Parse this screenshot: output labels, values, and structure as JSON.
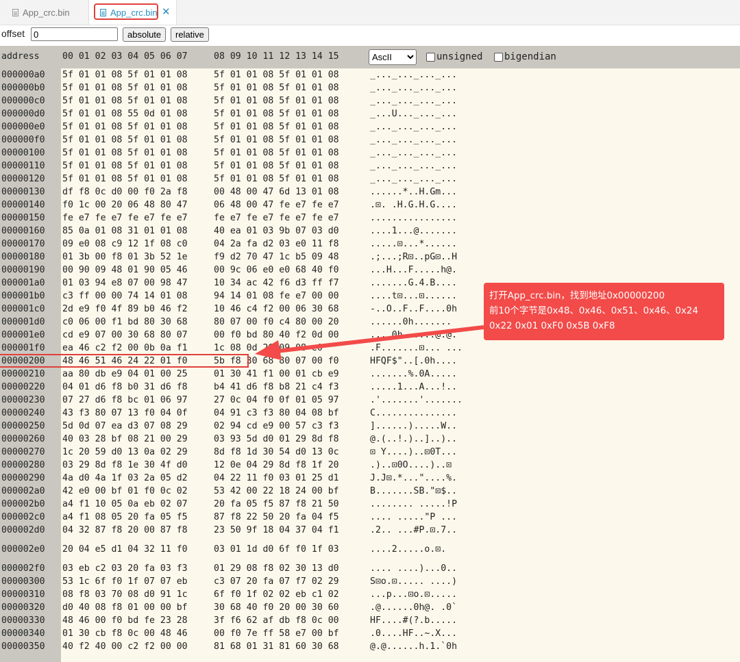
{
  "tabs": [
    {
      "label": "App_crc.bin",
      "active": false
    },
    {
      "label": "App_crc.bin",
      "active": true
    }
  ],
  "toolbar": {
    "offset_label": "offset",
    "offset_value": "0",
    "absolute_label": "absolute",
    "relative_label": "relative"
  },
  "header": {
    "address_label": "address",
    "cols_left": "00 01 02 03 04 05 06 07",
    "cols_right": "08 09 10 11 12 13 14 15",
    "encoding": "AscII",
    "unsigned_label": "unsigned",
    "bigendian_label": "bigendian"
  },
  "rows": [
    {
      "addr": "000000a0",
      "h1": "5f 01 01 08 5f 01 01 08",
      "h2": "5f 01 01 08 5f 01 01 08",
      "ascii": "_..._..._..._..."
    },
    {
      "addr": "000000b0",
      "h1": "5f 01 01 08 5f 01 01 08",
      "h2": "5f 01 01 08 5f 01 01 08",
      "ascii": "_..._..._..._..."
    },
    {
      "addr": "000000c0",
      "h1": "5f 01 01 08 5f 01 01 08",
      "h2": "5f 01 01 08 5f 01 01 08",
      "ascii": "_..._..._..._..."
    },
    {
      "addr": "000000d0",
      "h1": "5f 01 01 08 55 0d 01 08",
      "h2": "5f 01 01 08 5f 01 01 08",
      "ascii": "_...U..._..._..."
    },
    {
      "addr": "000000e0",
      "h1": "5f 01 01 08 5f 01 01 08",
      "h2": "5f 01 01 08 5f 01 01 08",
      "ascii": "_..._..._..._..."
    },
    {
      "addr": "000000f0",
      "h1": "5f 01 01 08 5f 01 01 08",
      "h2": "5f 01 01 08 5f 01 01 08",
      "ascii": "_..._..._..._..."
    },
    {
      "addr": "00000100",
      "h1": "5f 01 01 08 5f 01 01 08",
      "h2": "5f 01 01 08 5f 01 01 08",
      "ascii": "_..._..._..._..."
    },
    {
      "addr": "00000110",
      "h1": "5f 01 01 08 5f 01 01 08",
      "h2": "5f 01 01 08 5f 01 01 08",
      "ascii": "_..._..._..._..."
    },
    {
      "addr": "00000120",
      "h1": "5f 01 01 08 5f 01 01 08",
      "h2": "5f 01 01 08 5f 01 01 08",
      "ascii": "_..._..._..._..."
    },
    {
      "addr": "00000130",
      "h1": "df f8 0c d0 00 f0 2a f8",
      "h2": "00 48 00 47 6d 13 01 08",
      "ascii": "......*..H.Gm..."
    },
    {
      "addr": "00000140",
      "h1": "f0 1c 00 20 06 48 80 47",
      "h2": "06 48 00 47 fe e7 fe e7",
      "ascii": ".⊡. .H.G.H.G...."
    },
    {
      "addr": "00000150",
      "h1": "fe e7 fe e7 fe e7 fe e7",
      "h2": "fe e7 fe e7 fe e7 fe e7",
      "ascii": "................"
    },
    {
      "addr": "00000160",
      "h1": "85 0a 01 08 31 01 01 08",
      "h2": "40 ea 01 03 9b 07 03 d0",
      "ascii": "....1...@......."
    },
    {
      "addr": "00000170",
      "h1": "09 e0 08 c9 12 1f 08 c0",
      "h2": "04 2a fa d2 03 e0 11 f8",
      "ascii": ".....⊡...*......"
    },
    {
      "addr": "00000180",
      "h1": "01 3b 00 f8 01 3b 52 1e",
      "h2": "f9 d2 70 47 1c b5 09 48",
      "ascii": ".;...;R⊡..pG⊡..H"
    },
    {
      "addr": "00000190",
      "h1": "00 90 09 48 01 90 05 46",
      "h2": "00 9c 06 e0 e0 68 40 f0",
      "ascii": "...H...F.....h@."
    },
    {
      "addr": "000001a0",
      "h1": "01 03 94 e8 07 00 98 47",
      "h2": "10 34 ac 42 f6 d3 ff f7",
      "ascii": ".......G.4.B...."
    },
    {
      "addr": "000001b0",
      "h1": "c3 ff 00 00 74 14 01 08",
      "h2": "94 14 01 08 fe e7 00 00",
      "ascii": "....t⊡...⊡......"
    },
    {
      "addr": "000001c0",
      "h1": "2d e9 f0 4f 89 b0 46 f2",
      "h2": "10 46 c4 f2 00 06 30 68",
      "ascii": "-..O..F..F....0h"
    },
    {
      "addr": "000001d0",
      "h1": "c0 06 00 f1 bd 80 30 68",
      "h2": "80 07 00 f0 c4 80 00 20",
      "ascii": "......0h....... "
    },
    {
      "addr": "000001e0",
      "h1": "cd e9 07 00 30 68 80 07",
      "h2": "00 f0 bd 80 40 f2 0d 00",
      "ascii": "....0h......@.@."
    },
    {
      "addr": "000001f0",
      "h1": "ea 46 c2 f2 00 0b 0a f1",
      "h2": "1c 08 0d 20 09 08 e0",
      "ascii": ".F.......⊡... ..."
    },
    {
      "addr": "00000200",
      "h1": "48 46 51 46 24 22 01 f0",
      "h2": "5b f8 30 68 80 07 00 f0",
      "ascii": "HFQF$\"..[.0h...."
    },
    {
      "addr": "00000210",
      "h1": "aa 80 db e9 04 01 00 25",
      "h2": "01 30 41 f1 00 01 cb e9",
      "ascii": ".......%.0A....."
    },
    {
      "addr": "00000220",
      "h1": "04 01 d6 f8 b0 31 d6 f8",
      "h2": "b4 41 d6 f8 b8 21 c4 f3",
      "ascii": ".....1...A...!.."
    },
    {
      "addr": "00000230",
      "h1": "07 27 d6 f8 bc 01 06 97",
      "h2": "27 0c 04 f0 0f 01 05 97",
      "ascii": ".'.......'......."
    },
    {
      "addr": "00000240",
      "h1": "43 f3 80 07 13 f0 04 0f",
      "h2": "04 91 c3 f3 80 04 08 bf",
      "ascii": "C..............."
    },
    {
      "addr": "00000250",
      "h1": "5d 0d 07 ea d3 07 08 29",
      "h2": "02 94 cd e9 00 57 c3 f3",
      "ascii": "]......).....W.."
    },
    {
      "addr": "00000260",
      "h1": "40 03 28 bf 08 21 00 29",
      "h2": "03 93 5d d0 01 29 8d f8",
      "ascii": "@.(..!.)..]..).."
    },
    {
      "addr": "00000270",
      "h1": "1c 20 59 d0 13 0a 02 29",
      "h2": "8d f8 1d 30 54 d0 13 0c",
      "ascii": "⊡ Y....)..⊡0T..."
    },
    {
      "addr": "00000280",
      "h1": "03 29 8d f8 1e 30 4f d0",
      "h2": "12 0e 04 29 8d f8 1f 20",
      "ascii": ".)..⊡0O....)..⊡ "
    },
    {
      "addr": "00000290",
      "h1": "4a d0 4a 1f 03 2a 05 d2",
      "h2": "04 22 11 f0 03 01 25 d1",
      "ascii": "J.J⊡.*...\"....%."
    },
    {
      "addr": "000002a0",
      "h1": "42 e0 00 bf 01 f0 0c 02",
      "h2": "53 42 00 22 18 24 00 bf",
      "ascii": "B.......SB.\"⊡$.."
    },
    {
      "addr": "000002b0",
      "h1": "a4 f1 10 05 0a eb 02 07",
      "h2": "20 fa 05 f5 87 f8 21 50",
      "ascii": "........ .....!P"
    },
    {
      "addr": "000002c0",
      "h1": "a4 f1 08 05 20 fa 05 f5",
      "h2": "87 f8 22 50 20 fa 04 f5",
      "ascii": ".... .....\"P ..."
    },
    {
      "addr": "000002d0",
      "h1": "04 32 87 f8 20 00 87 f8",
      "h2": "23 50 9f 18 04 37 04 f1",
      "ascii": ".2.. ...#P.⊡.7.."
    },
    {
      "addr": "000002e0",
      "h1": "20 04 e5 d1 04 32 11 f0",
      "h2": "03 01 1d d0 6f f0 1f 03",
      "ascii": "....2.....o.⊡."
    },
    {
      "addr": "000002f0",
      "h1": "03 eb c2 03 20 fa 03 f3",
      "h2": "01 29 08 f8 02 30 13 d0",
      "ascii": ".... ....)...0.."
    },
    {
      "addr": "00000300",
      "h1": "53 1c 6f f0 1f 07 07 eb",
      "h2": "c3 07 20 fa 07 f7 02 29",
      "ascii": "S⊡o.⊡..... ....)"
    },
    {
      "addr": "00000310",
      "h1": "08 f8 03 70 08 d0 91 1c",
      "h2": "6f f0 1f 02 02 eb c1 02",
      "ascii": "...p...⊡o.⊡....."
    },
    {
      "addr": "00000320",
      "h1": "d0 40 08 f8 01 00 00 bf",
      "h2": "30 68 40 f0 20 00 30 60",
      "ascii": ".@......0h@. .0`"
    },
    {
      "addr": "00000330",
      "h1": "48 46 00 f0 bd fe 23 28",
      "h2": "3f f6 62 af db f8 0c 00",
      "ascii": "HF....#(?.b....."
    },
    {
      "addr": "00000340",
      "h1": "01 30 cb f8 0c 00 48 46",
      "h2": "00 f0 7e ff 58 e7 00 bf",
      "ascii": ".0....HF..~.X..."
    },
    {
      "addr": "00000350",
      "h1": "40 f2 40 00 c2 f2 00 00",
      "h2": "81 68 01 31 81 60 30 68",
      "ascii": "@.@......h.1.`0h"
    }
  ],
  "callout": {
    "line1": "打开App_crc.bin，找到地址0x00000200",
    "line2": "前10个字节是0x48、0x46、0x51、0x46、0x24",
    "line3": "0x22 0x01 0xF0 0x5B 0xF8"
  },
  "colors": {
    "annotation_red": "#e0403a",
    "callout_bg": "#f24b49",
    "hex_bg": "#fdf8ec",
    "header_bg": "#c9c7c0",
    "active_tab_text": "#2a8fbf"
  }
}
